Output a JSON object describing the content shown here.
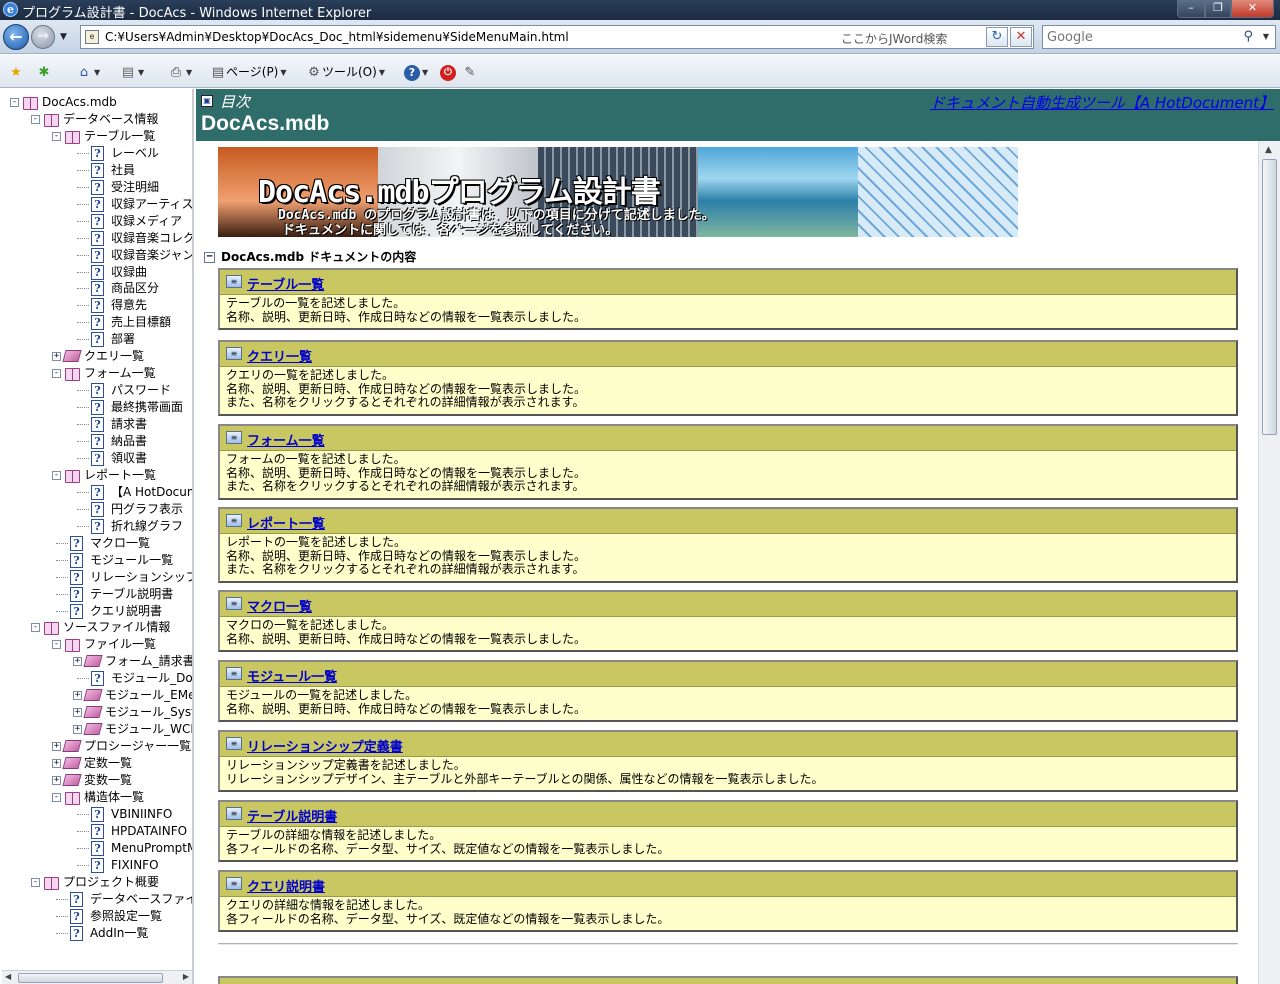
{
  "window": {
    "title": "プログラム設計書 - DocAcs - Windows Internet Explorer",
    "app_icon": "e"
  },
  "address_bar": {
    "url": "C:¥Users¥Admin¥Desktop¥DocAcs_Doc_html¥sidemenu¥SideMenuMain.html",
    "jword_label": "ここからJWord検索"
  },
  "search": {
    "placeholder": "Google"
  },
  "toolbar": {
    "page_label": "ページ(P)",
    "tools_label": "ツール(O)"
  },
  "tree": {
    "items": [
      {
        "label": "DocAcs.mdb"
      },
      {
        "label": "データベース情報"
      },
      {
        "label": "テーブル一覧"
      },
      {
        "label": "レーベル"
      },
      {
        "label": "社員"
      },
      {
        "label": "受注明細"
      },
      {
        "label": "収録アーティスト"
      },
      {
        "label": "収録メディア"
      },
      {
        "label": "収録音楽コレクシ"
      },
      {
        "label": "収録音楽ジャンル"
      },
      {
        "label": "収録曲"
      },
      {
        "label": "商品区分"
      },
      {
        "label": "得意先"
      },
      {
        "label": "売上目標額"
      },
      {
        "label": "部署"
      },
      {
        "label": "クエリ一覧"
      },
      {
        "label": "フォーム一覧"
      },
      {
        "label": "パスワード"
      },
      {
        "label": "最終携帯画面"
      },
      {
        "label": "請求書"
      },
      {
        "label": "納品書"
      },
      {
        "label": "領収書"
      },
      {
        "label": "レポート一覧"
      },
      {
        "label": "【A HotDocumen"
      },
      {
        "label": "円グラフ表示"
      },
      {
        "label": "折れ線グラフ"
      },
      {
        "label": "マクロ一覧"
      },
      {
        "label": "モジュール一覧"
      },
      {
        "label": "リレーションシップ定義書"
      },
      {
        "label": "テーブル説明書"
      },
      {
        "label": "クエリ説明書"
      },
      {
        "label": "ソースファイル情報"
      },
      {
        "label": "ファイル一覧"
      },
      {
        "label": "フォーム_請求書"
      },
      {
        "label": "モジュール_DocSer"
      },
      {
        "label": "モジュール_EMessa"
      },
      {
        "label": "モジュール_System"
      },
      {
        "label": "モジュール_WCError"
      },
      {
        "label": "プロシージャー一覧"
      },
      {
        "label": "定数一覧"
      },
      {
        "label": "変数一覧"
      },
      {
        "label": "構造体一覧"
      },
      {
        "label": "VBINIINFO"
      },
      {
        "label": "HPDATAINFO"
      },
      {
        "label": "MenuPromptMap"
      },
      {
        "label": "FIXINFO"
      },
      {
        "label": "プロジェクト概要"
      },
      {
        "label": "データベースファイル情"
      },
      {
        "label": "参照設定一覧"
      },
      {
        "label": "AddIn一覧"
      }
    ]
  },
  "header": {
    "toc_label": "目次",
    "tool_link": "ドキュメント自動生成ツール【A HotDocument】",
    "db_title": "DocAcs.mdb"
  },
  "banner": {
    "title": "DocAcs.mdbプログラム設計書",
    "line1": "DocAcs.mdb のプログラム設計書は、以下の項目に分けて記述しました。",
    "line2": "ドキュメントに関しては、各ページを参照してください。"
  },
  "section": {
    "title": "DocAcs.mdb ドキュメントの内容"
  },
  "cards": [
    {
      "title": "テーブル一覧",
      "lines": [
        "テーブルの一覧を記述しました。",
        "名称、説明、更新日時、作成日時などの情報を一覧表示しました。"
      ]
    },
    {
      "title": "クエリ一覧",
      "lines": [
        "クエリの一覧を記述しました。",
        "名称、説明、更新日時、作成日時などの情報を一覧表示しました。",
        "また、名称をクリックするとそれぞれの詳細情報が表示されます。"
      ]
    },
    {
      "title": "フォーム一覧",
      "lines": [
        "フォームの一覧を記述しました。",
        "名称、説明、更新日時、作成日時などの情報を一覧表示しました。",
        "また、名称をクリックするとそれぞれの詳細情報が表示されます。"
      ]
    },
    {
      "title": "レポート一覧",
      "lines": [
        "レポートの一覧を記述しました。",
        "名称、説明、更新日時、作成日時などの情報を一覧表示しました。",
        "また、名称をクリックするとそれぞれの詳細情報が表示されます。"
      ]
    },
    {
      "title": "マクロ一覧",
      "lines": [
        "マクロの一覧を記述しました。",
        "名称、説明、更新日時、作成日時などの情報を一覧表示しました。"
      ]
    },
    {
      "title": "モジュール一覧",
      "lines": [
        "モジュールの一覧を記述しました。",
        "名称、説明、更新日時、作成日時などの情報を一覧表示しました。"
      ]
    },
    {
      "title": "リレーションシップ定義書",
      "lines": [
        "リレーションシップ定義書を記述しました。",
        "リレーションシップデザイン、主テーブルと外部キーテーブルとの関係、属性などの情報を一覧表示しました。"
      ]
    },
    {
      "title": "テーブル説明書",
      "lines": [
        "テーブルの詳細な情報を記述しました。",
        "各フィールドの名称、データ型、サイズ、既定値などの情報を一覧表示しました。"
      ]
    },
    {
      "title": "クエリ説明書",
      "lines": [
        "クエリの詳細な情報を記述しました。",
        "各フィールドの名称、データ型、サイズ、既定値などの情報を一覧表示しました。"
      ]
    }
  ]
}
